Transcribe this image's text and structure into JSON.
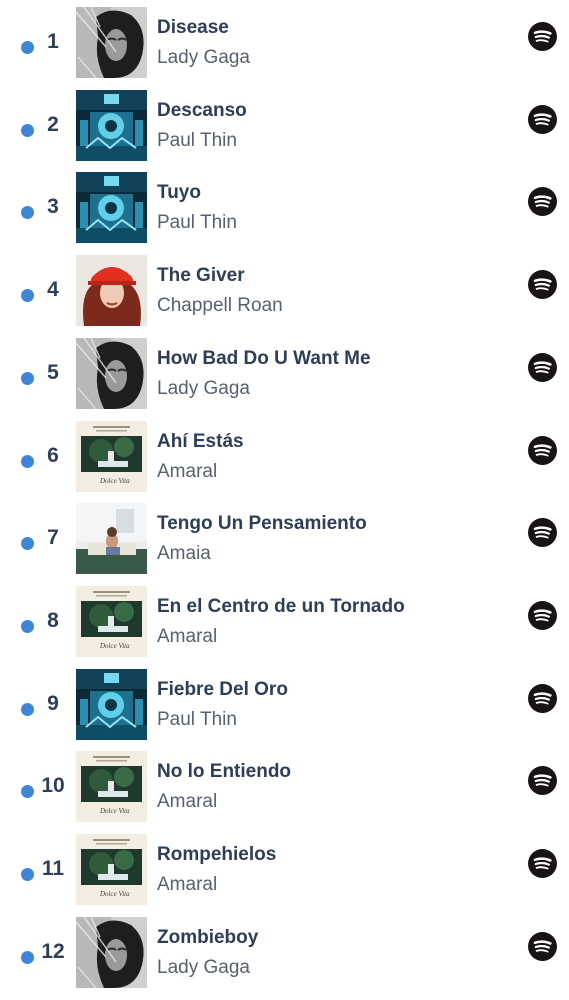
{
  "tracks": [
    {
      "rank": "1",
      "title": "Disease",
      "artist": "Lady Gaga",
      "cover": "cover-mayhem"
    },
    {
      "rank": "2",
      "title": "Descanso",
      "artist": "Paul Thin",
      "cover": "cover-blue-city"
    },
    {
      "rank": "3",
      "title": "Tuyo",
      "artist": "Paul Thin",
      "cover": "cover-blue-city"
    },
    {
      "rank": "4",
      "title": "The Giver",
      "artist": "Chappell Roan",
      "cover": "cover-red-helmet"
    },
    {
      "rank": "5",
      "title": "How Bad Do U Want Me",
      "artist": "Lady Gaga",
      "cover": "cover-mayhem"
    },
    {
      "rank": "6",
      "title": "Ahí Estás",
      "artist": "Amaral",
      "cover": "cover-dolce-vita"
    },
    {
      "rank": "7",
      "title": "Tengo Un Pensamiento",
      "artist": "Amaia",
      "cover": "cover-amaia-room"
    },
    {
      "rank": "8",
      "title": "En el Centro de un Tornado",
      "artist": "Amaral",
      "cover": "cover-dolce-vita"
    },
    {
      "rank": "9",
      "title": "Fiebre Del Oro",
      "artist": "Paul Thin",
      "cover": "cover-blue-city"
    },
    {
      "rank": "10",
      "title": "No lo Entiendo",
      "artist": "Amaral",
      "cover": "cover-dolce-vita"
    },
    {
      "rank": "11",
      "title": "Rompehielos",
      "artist": "Amaral",
      "cover": "cover-dolce-vita"
    },
    {
      "rank": "12",
      "title": "Zombieboy",
      "artist": "Lady Gaga",
      "cover": "cover-mayhem"
    }
  ],
  "icons": {
    "bullet": "bullet-dot-icon",
    "play": "spotify-icon"
  },
  "colors": {
    "bullet": "#3f86d6",
    "title": "#2d3e56",
    "artist": "#59616d",
    "spotify": "#191414"
  }
}
